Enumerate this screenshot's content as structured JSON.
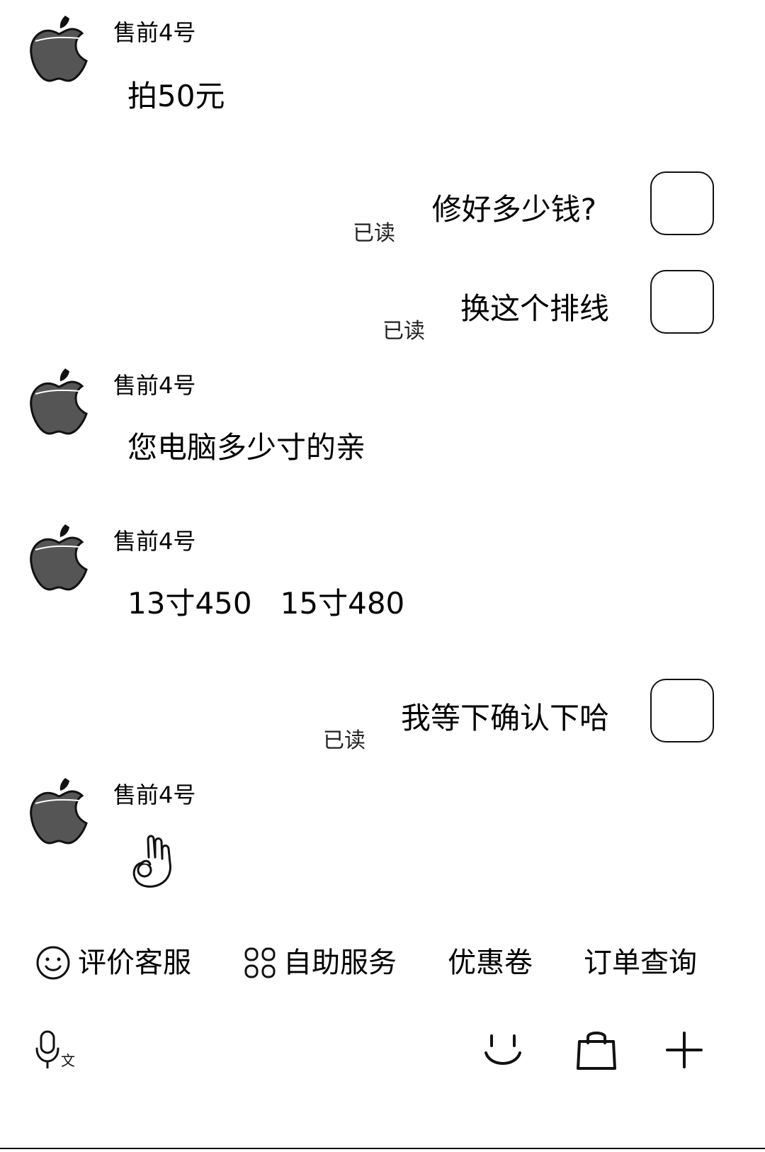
{
  "messages": [
    {
      "side": "left",
      "sender": "售前4号",
      "text": "拍50元"
    },
    {
      "side": "right",
      "text": "修好多少钱?",
      "status": "已读"
    },
    {
      "side": "right",
      "text": "换这个排线",
      "status": "已读"
    },
    {
      "side": "left",
      "sender": "售前4号",
      "text": "您电脑多少寸的亲"
    },
    {
      "side": "left",
      "sender": "售前4号",
      "text": "13寸450   15寸480"
    },
    {
      "side": "right",
      "text": "我等下确认下哈",
      "status": "已读"
    },
    {
      "side": "left",
      "sender": "售前4号",
      "sticker": "ok-hand-emoji"
    }
  ],
  "quick_actions": [
    {
      "label": "评价客服",
      "icon": "smiley-icon"
    },
    {
      "label": "自助服务",
      "icon": "grid-icon"
    },
    {
      "label": "优惠卷"
    },
    {
      "label": "订单查询"
    }
  ],
  "input_bar": {
    "voice_icon": "voice-to-text-icon",
    "emoji_icon": "emoji-icon",
    "shop_icon": "shopping-bag-icon",
    "more_icon": "plus-icon"
  }
}
